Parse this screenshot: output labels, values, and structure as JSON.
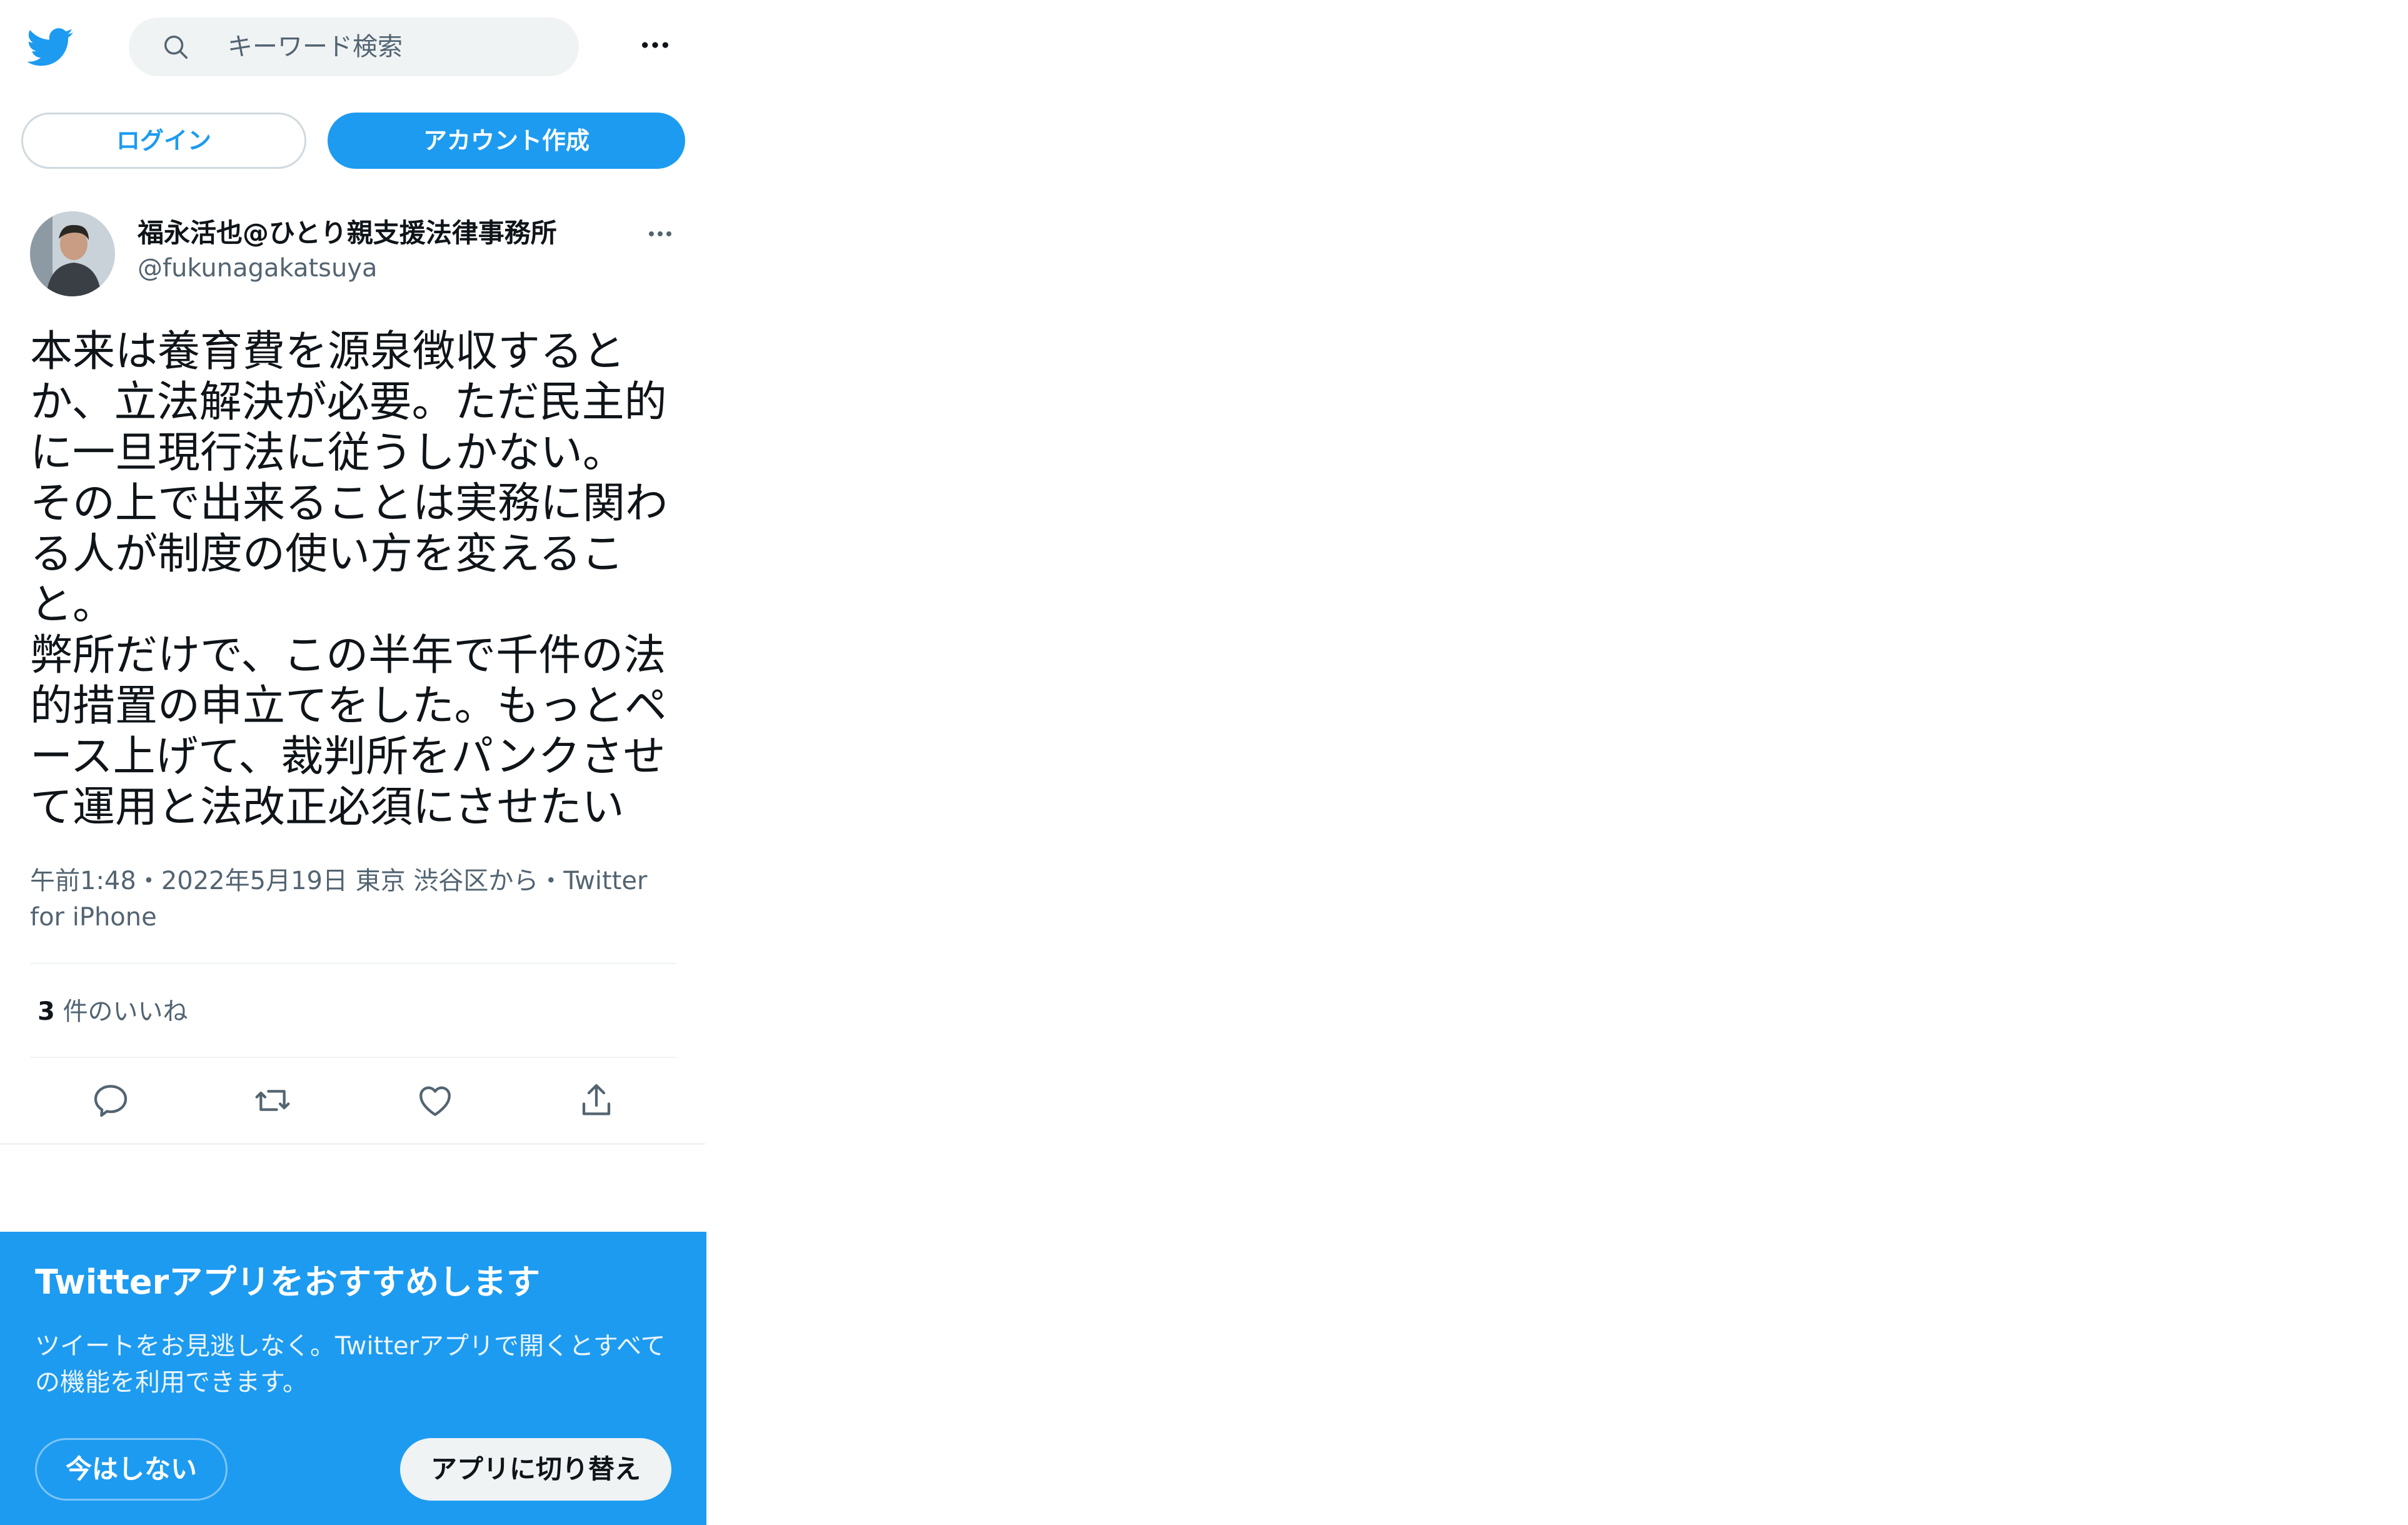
{
  "colors": {
    "accent": "#1d9bf0",
    "text": "#0f1419",
    "secondary": "#536471"
  },
  "header": {
    "search_placeholder": "キーワード検索",
    "login_label": "ログイン",
    "signup_label": "アカウント作成"
  },
  "tweet": {
    "display_name": "福永活也@ひとり親支援法律事務所",
    "handle": "@fukunagakatsuya",
    "text": "本来は養育費を源泉徴収すると\nか、立法解決が必要。ただ民主的\nに一旦現行法に従うしかない。\nその上で出来ることは実務に関わ\nる人が制度の使い方を変えるこ\nと。\n弊所だけで、この半年で千件の法\n的措置の申立てをした。もっとペ\nース上げて、裁判所をパンクさせ\nて運用と法改正必須にさせたい",
    "meta": "午前1:48・2022年5月19日 東京 渋谷区から・Twitter for iPhone",
    "likes_count": "3",
    "likes_label": "件のいいね",
    "actions": [
      "reply-icon",
      "retweet-icon",
      "like-icon",
      "share-icon"
    ]
  },
  "promo": {
    "title": "Twitterアプリをおすすめします",
    "body": "ツイートをお見逃しなく。Twitterアプリで開くとすべての機能を利用できます。",
    "not_now_label": "今はしない",
    "switch_label": "アプリに切り替え"
  }
}
